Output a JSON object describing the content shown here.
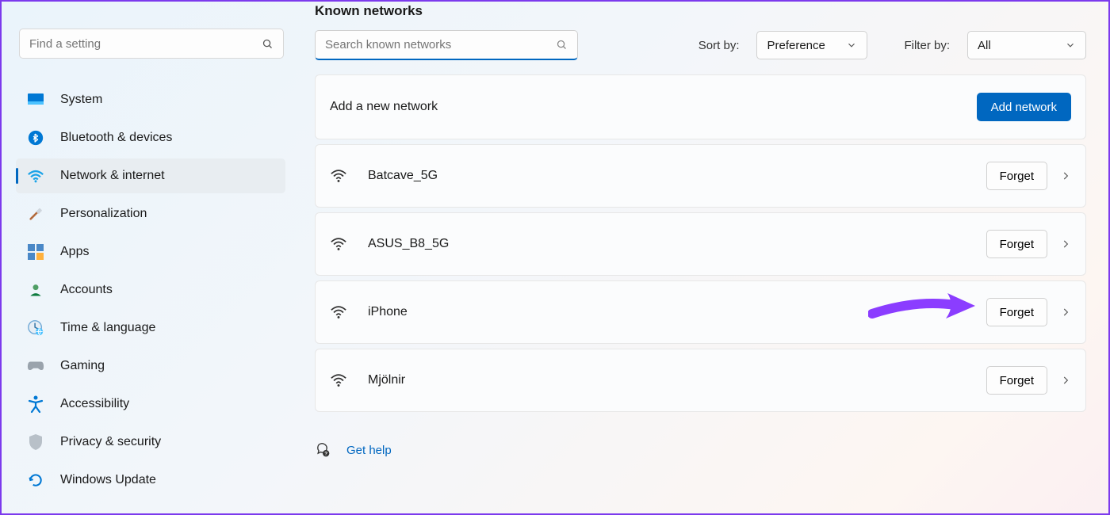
{
  "sidebar": {
    "search_placeholder": "Find a setting",
    "items": [
      {
        "label": "System"
      },
      {
        "label": "Bluetooth & devices"
      },
      {
        "label": "Network & internet",
        "active": true
      },
      {
        "label": "Personalization"
      },
      {
        "label": "Apps"
      },
      {
        "label": "Accounts"
      },
      {
        "label": "Time & language"
      },
      {
        "label": "Gaming"
      },
      {
        "label": "Accessibility"
      },
      {
        "label": "Privacy & security"
      },
      {
        "label": "Windows Update"
      }
    ]
  },
  "main": {
    "heading": "Known networks",
    "search_placeholder": "Search known networks",
    "sort_label": "Sort by:",
    "sort_value": "Preference",
    "filter_label": "Filter by:",
    "filter_value": "All",
    "add_row_label": "Add a new network",
    "add_button": "Add network",
    "networks": [
      {
        "name": "Batcave_5G"
      },
      {
        "name": "ASUS_B8_5G"
      },
      {
        "name": "iPhone"
      },
      {
        "name": "Mjölnir"
      }
    ],
    "forget_label": "Forget",
    "help_label": "Get help"
  },
  "colors": {
    "accent": "#0067c0",
    "annotation": "#8b3dff"
  }
}
